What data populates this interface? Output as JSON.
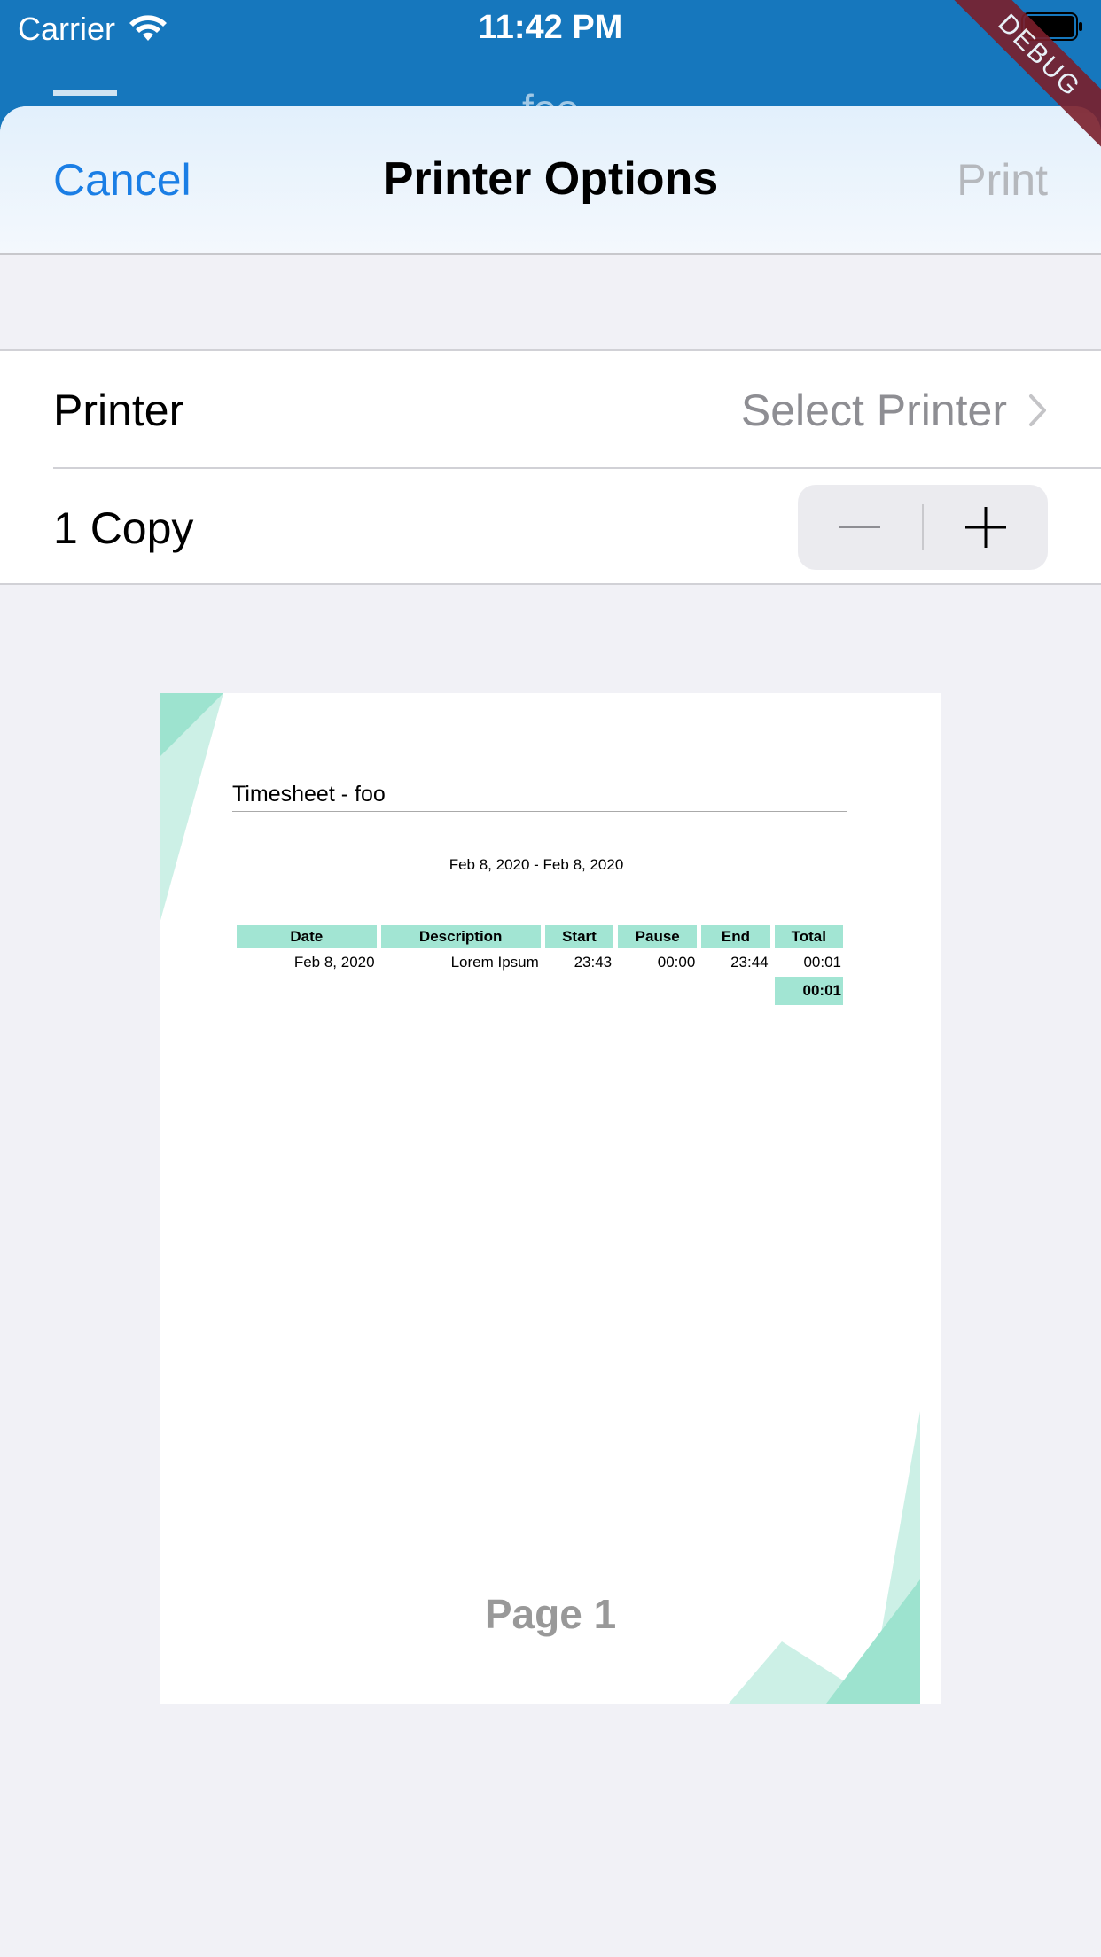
{
  "status": {
    "carrier": "Carrier",
    "time": "11:42 PM"
  },
  "app": {
    "title_peek": "foo",
    "debug_label": "DEBUG"
  },
  "sheet": {
    "cancel_label": "Cancel",
    "title": "Printer Options",
    "print_label": "Print",
    "printer_label": "Printer",
    "printer_value": "Select Printer",
    "copies_label": "1 Copy"
  },
  "preview": {
    "doc_title": "Timesheet - foo",
    "date_range": "Feb 8, 2020 - Feb 8, 2020",
    "columns": [
      "Date",
      "Description",
      "Start",
      "Pause",
      "End",
      "Total"
    ],
    "row": [
      "Feb 8, 2020",
      "Lorem Ipsum",
      "23:43",
      "00:00",
      "23:44",
      "00:01"
    ],
    "sum_total": "00:01",
    "page_label": "Page 1"
  },
  "colors": {
    "accent": "#1a7ee5",
    "app_bar": "#1677bd",
    "table_header": "#a2e5d3"
  }
}
